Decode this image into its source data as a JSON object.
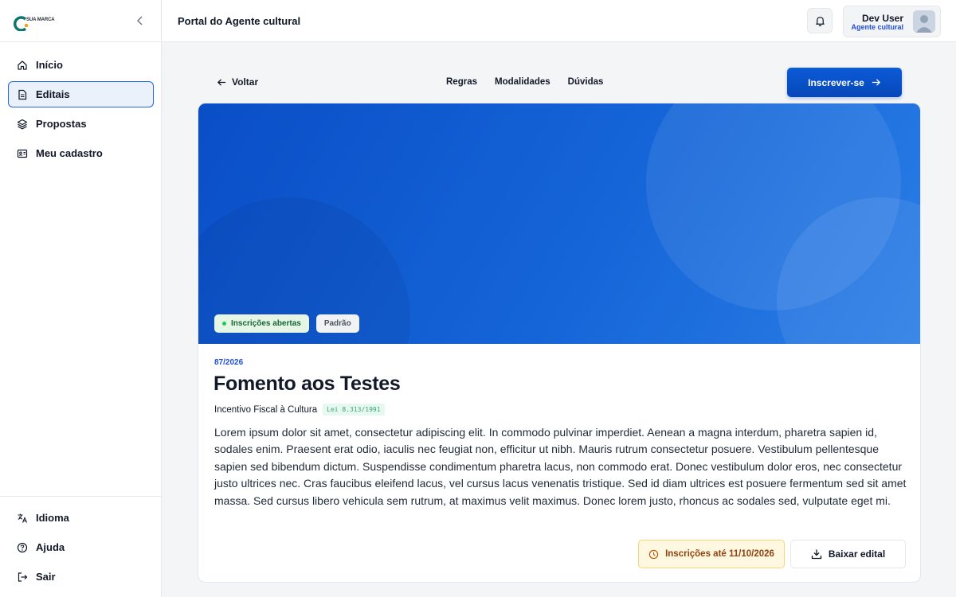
{
  "brand": {
    "logo_text": "SUA MARCA"
  },
  "sidebar": {
    "items": [
      {
        "label": "Início",
        "icon": "home-icon"
      },
      {
        "label": "Editais",
        "icon": "file-text-icon",
        "active": true
      },
      {
        "label": "Propostas",
        "icon": "layers-icon"
      },
      {
        "label": "Meu cadastro",
        "icon": "id-card-icon"
      }
    ],
    "bottom_items": [
      {
        "label": "Idioma",
        "icon": "translate-icon"
      },
      {
        "label": "Ajuda",
        "icon": "help-circle-icon"
      },
      {
        "label": "Sair",
        "icon": "logout-icon"
      }
    ]
  },
  "header": {
    "title": "Portal do Agente cultural",
    "user_name": "Dev User",
    "user_role": "Agente cultural"
  },
  "subnav": {
    "back_label": "Voltar",
    "links": [
      "Regras",
      "Modalidades",
      "Dúvidas"
    ],
    "signup_label": "Inscrever-se"
  },
  "edital": {
    "badge_status": "Inscrições abertas",
    "badge_type": "Padrão",
    "number": "87/2026",
    "title": "Fomento aos Testes",
    "category": "Incentivo Fiscal à Cultura",
    "law": "Lei 8.313/1991",
    "description": "Lorem ipsum dolor sit amet, consectetur adipiscing elit. In commodo pulvinar imperdiet. Aenean a magna interdum, pharetra sapien id, sodales enim. Praesent erat odio, iaculis nec feugiat non, efficitur ut nibh. Mauris rutrum consectetur posuere. Vestibulum pellentesque sapien sed bibendum dictum. Suspendisse condimentum pharetra lacus, non commodo erat. Donec vestibulum dolor eros, nec consectetur justo ultrices nec. Cras faucibus eleifend lacus, vel cursus lacus venenatis tristique. Sed id diam ultrices est posuere fermentum sed sit amet massa. Sed cursus libero vehicula sem rutrum, at maximus velit maximus. Donec lorem justo, rhoncus ac sodales sed, vulputate eget mi.",
    "deadline": "Inscrições até 11/10/2026",
    "download_label": "Baixar edital"
  },
  "colors": {
    "primary": "#0747b8",
    "accent": "#1d4ed8",
    "success": "#22c55e",
    "warning_bg": "#fef8e1"
  }
}
